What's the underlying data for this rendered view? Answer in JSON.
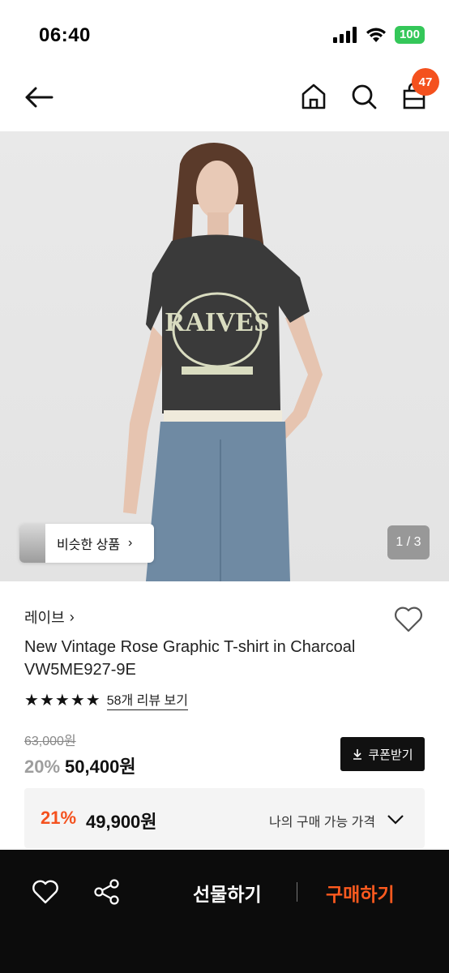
{
  "status": {
    "time": "06:40",
    "battery": "100"
  },
  "nav": {
    "cart_count": "47"
  },
  "hero": {
    "similar_label": "비슷한 상품",
    "page_indicator": "1 / 3"
  },
  "product": {
    "brand": "레이브",
    "name_line1": "New Vintage Rose Graphic T-shirt in Charcoal",
    "name_line2": "VW5ME927-9E",
    "rating_stars": 5,
    "review_link": "58개 리뷰 보기",
    "original_price": "63,000원",
    "discount_rate": "20%",
    "sale_price": "50,400원",
    "coupon_label": "쿠폰받기"
  },
  "best_price": {
    "discount_rate": "21%",
    "price": "49,900원",
    "label": "나의 구매 가능 가격"
  },
  "bottom_bar": {
    "gift_label": "선물하기",
    "buy_label": "구매하기"
  },
  "colors": {
    "accent": "#f4511e",
    "buy": "#ff5a1f",
    "battery": "#34c759"
  }
}
